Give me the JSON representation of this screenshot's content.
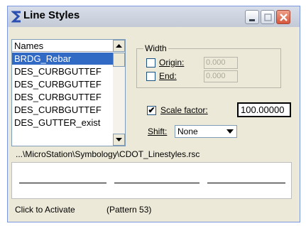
{
  "window": {
    "title": "Line Styles",
    "controls": [
      "minimize",
      "maximize",
      "close"
    ]
  },
  "names_list": {
    "header": "Names",
    "items": [
      "BRDG_Rebar",
      "DES_CURBGUTTEF",
      "DES_CURBGUTTEF",
      "DES_CURBGUTTEF",
      "DES_CURBGUTTEF",
      "DES_GUTTER_exist"
    ],
    "selected_index": 0
  },
  "width_group": {
    "label": "Width",
    "origin": {
      "label": "Origin:",
      "checked": false,
      "value": "0.000"
    },
    "end": {
      "label": "End:",
      "checked": false,
      "value": "0.000"
    }
  },
  "scale_factor": {
    "label": "Scale factor:",
    "checked": true,
    "check_glyph": "✔",
    "value": "100.00000"
  },
  "shift": {
    "label": "Shift:",
    "value": "None"
  },
  "file_path": "...\\MicroStation\\Symbology\\CDOT_Linestyles.rsc",
  "status": {
    "left": "Click to Activate",
    "right": "(Pattern 53)"
  },
  "colors": {
    "selection": "#316ac5",
    "dialog_bg": "#ece9d8",
    "close_button": "#d6573b"
  }
}
